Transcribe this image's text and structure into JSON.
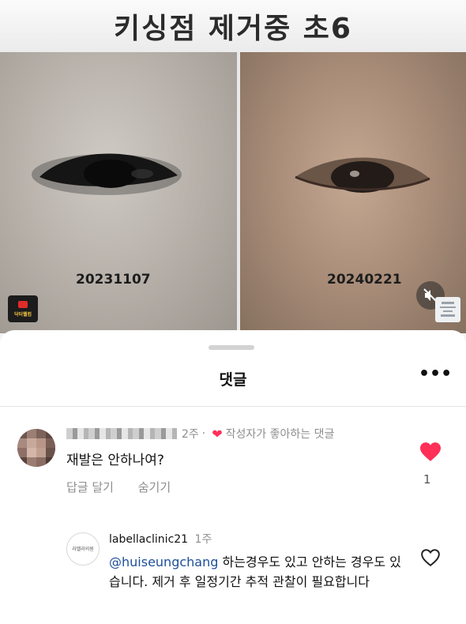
{
  "video": {
    "title": "키싱점 제거중 초6",
    "left_date": "20231107",
    "right_date": "20240221",
    "channel_logo_text": "닥터웰컴",
    "mute_icon": "speaker-muted-icon"
  },
  "sheet": {
    "title": "댓글",
    "more_label": "•••",
    "comments": [
      {
        "username": "",
        "time": "2주",
        "separator": "·",
        "author_liked_label": "작성자가 좋아하는 댓글",
        "text": "재발은 안하나여?",
        "reply_action": "답글 달기",
        "hide_action": "숨기기",
        "like_count": "1"
      }
    ],
    "reply": {
      "username": "labellaclinic21",
      "time": "1주",
      "avatar_text": "라벨라의원",
      "mention": "@huiseungchang",
      "text": " 하는경우도 있고 안하는 경우도 있습니다. 제거 후 일정기간 추적 관찰이 필요합니다"
    }
  },
  "colors": {
    "like_red": "#ff2f58",
    "mention_blue": "#1d4f99",
    "muted_gray": "#8e8e8e"
  }
}
